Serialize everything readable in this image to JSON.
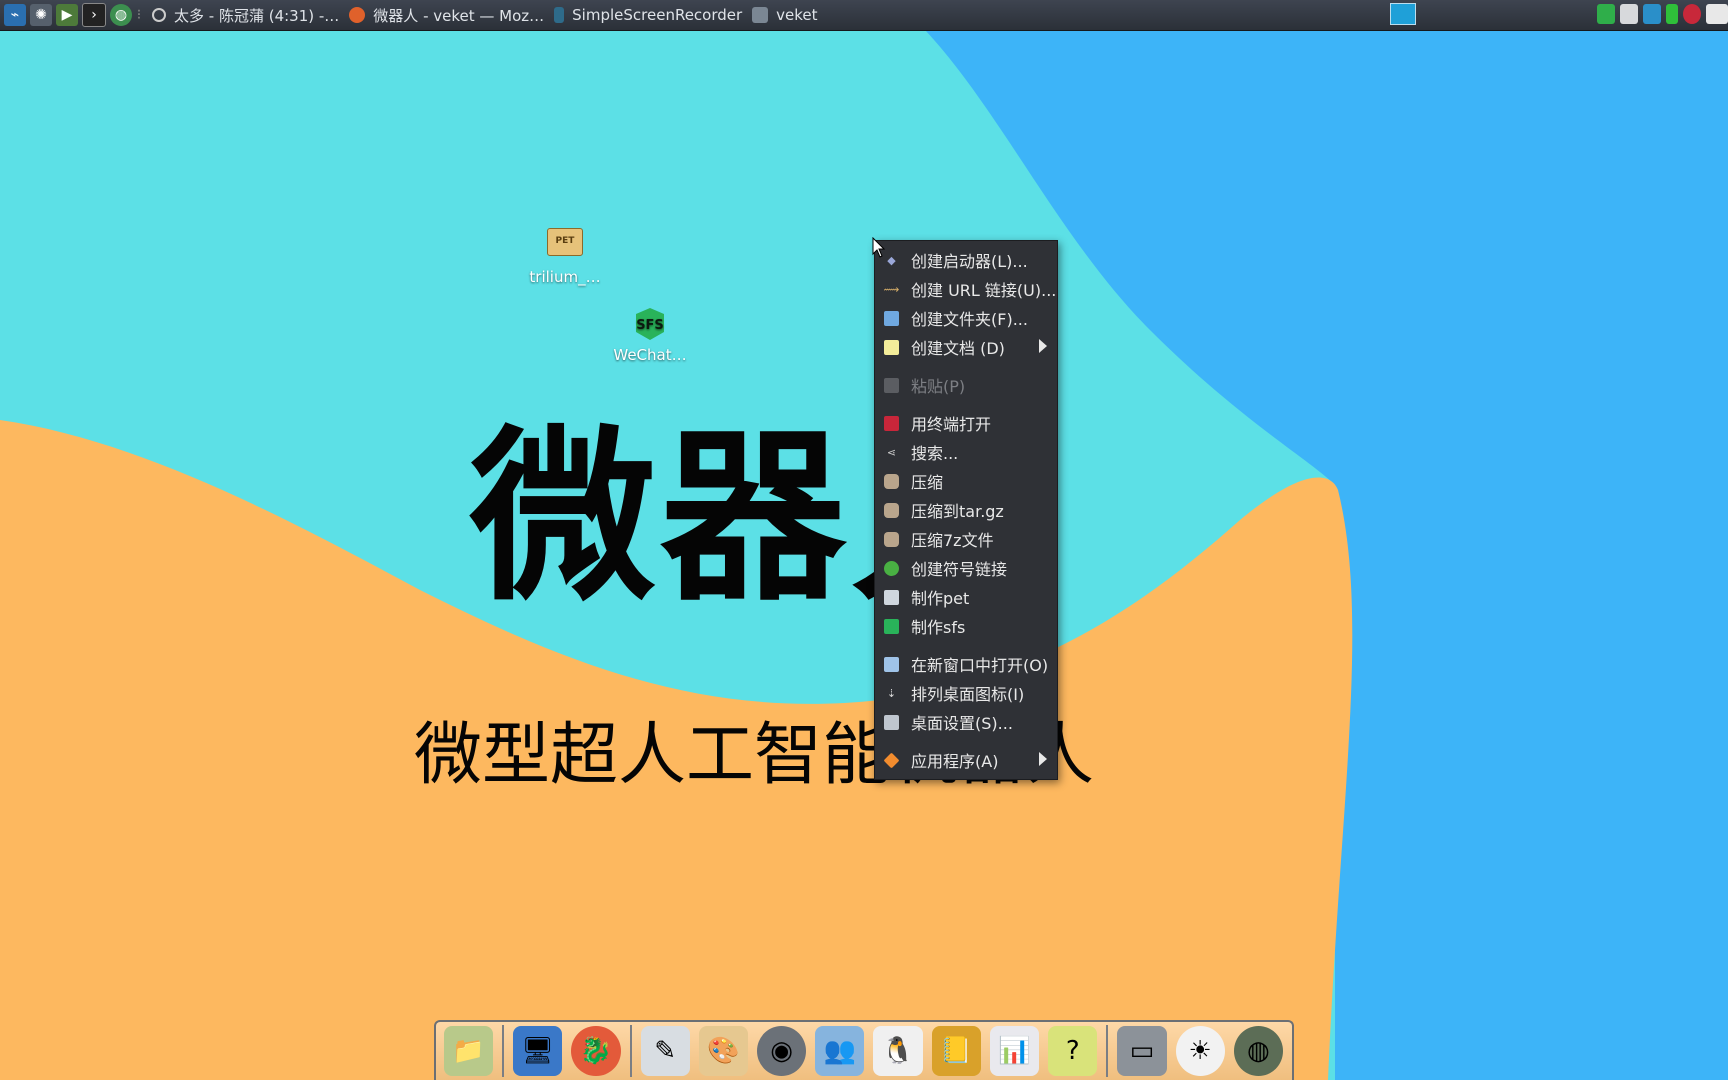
{
  "taskbar": {
    "launcher_icons": [
      "system-monitor-icon",
      "settings-icon",
      "play-icon",
      "terminal-icon",
      "globe-icon"
    ],
    "tasks": [
      {
        "label": "太多 - 陈冠蒲 (4:31) -…",
        "icon": "music-icon"
      },
      {
        "label": "微器人 - veket — Moz…",
        "icon": "firefox-icon"
      },
      {
        "label": "SimpleScreenRecorder",
        "icon": "recorder-icon"
      },
      {
        "label": "veket",
        "icon": "folder-icon"
      }
    ],
    "tray_icons": [
      "shield-icon",
      "clipboard-icon",
      "network-icon",
      "battery-icon",
      "record-icon",
      "keyboard-icon"
    ]
  },
  "desktop": {
    "icons": [
      {
        "label": "trilium_…",
        "badge": "PET"
      },
      {
        "label": "WeChat…",
        "badge": "SFS"
      }
    ],
    "wallpaper_title": "微器人",
    "wallpaper_subtitle": "微型超人工智能机器人",
    "colors": {
      "cyan": "#5ce0e6",
      "blue": "#3db4f8",
      "orange": "#fdb85f"
    }
  },
  "context_menu": {
    "items": [
      {
        "label": "创建启动器(L)...",
        "icon": "launcher-icon"
      },
      {
        "label": "创建 URL 链接(U)...",
        "icon": "url-link-icon"
      },
      {
        "label": "创建文件夹(F)...",
        "icon": "folder-icon"
      },
      {
        "label": "创建文档 (D)",
        "icon": "document-icon",
        "submenu": true
      },
      {
        "label": "粘贴(P)",
        "icon": "paste-icon",
        "disabled": true
      },
      {
        "label": "用终端打开",
        "icon": "terminal-icon"
      },
      {
        "label": "搜索...",
        "icon": "search-icon"
      },
      {
        "label": "压缩",
        "icon": "compress-icon"
      },
      {
        "label": "压缩到tar.gz",
        "icon": "compress-icon"
      },
      {
        "label": "压缩7z文件",
        "icon": "compress-icon"
      },
      {
        "label": "创建符号链接",
        "icon": "symlink-icon"
      },
      {
        "label": "制作pet",
        "icon": "pet-icon"
      },
      {
        "label": "制作sfs",
        "icon": "sfs-icon"
      },
      {
        "label": "在新窗口中打开(O)",
        "icon": "new-window-icon"
      },
      {
        "label": "排列桌面图标(I)",
        "icon": "sort-icon"
      },
      {
        "label": "桌面设置(S)...",
        "icon": "desktop-settings-icon"
      },
      {
        "label": "应用程序(A)",
        "icon": "applications-icon",
        "submenu": true
      }
    ]
  },
  "dock": {
    "items": [
      "file-manager-icon",
      "monitor-icon",
      "dragon-icon",
      "notepad-icon",
      "paint-icon",
      "media-player-icon",
      "users-icon",
      "penguin-icon",
      "book-icon",
      "chart-icon",
      "help-icon",
      "drive-icon",
      "brightness-icon",
      "globe-icon"
    ]
  }
}
